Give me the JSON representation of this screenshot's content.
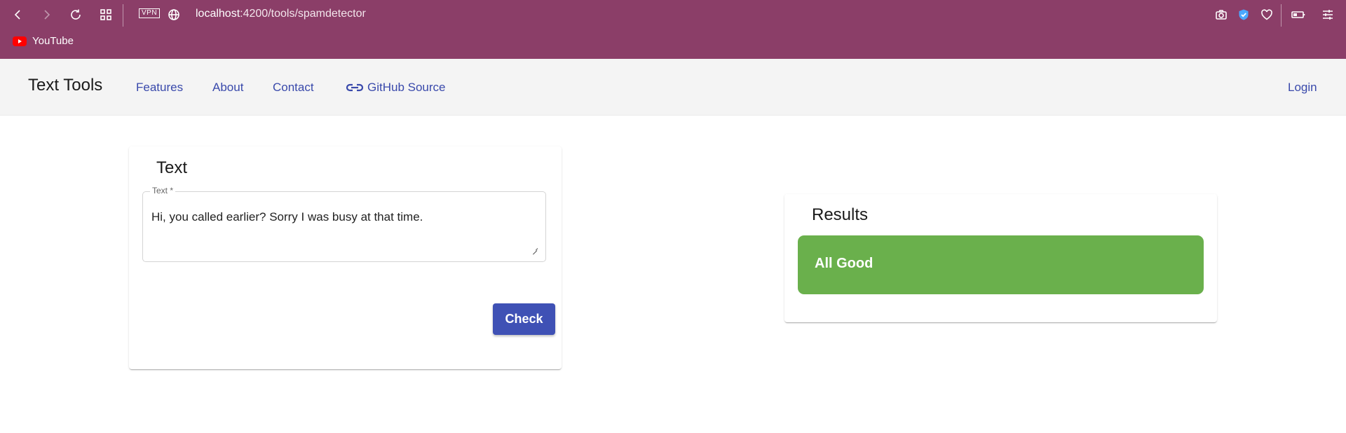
{
  "browser": {
    "vpn_label": "VPN",
    "url_host": "localhost",
    "url_path": ":4200/tools/spamdetector",
    "bookmarks": [
      {
        "label": "YouTube",
        "icon": "youtube-icon"
      }
    ]
  },
  "app": {
    "brand": "Text Tools",
    "nav": {
      "features": "Features",
      "about": "About",
      "contact": "Contact",
      "github": "GitHub Source",
      "login": "Login"
    },
    "accent_color": "#3f51b5"
  },
  "input_card": {
    "title": "Text",
    "field_label": "Text *",
    "field_value": "Hi, you called earlier? Sorry I was busy at that time.",
    "button_label": "Check"
  },
  "results_card": {
    "title": "Results",
    "status": "All Good",
    "status_color": "#6ab04c"
  }
}
